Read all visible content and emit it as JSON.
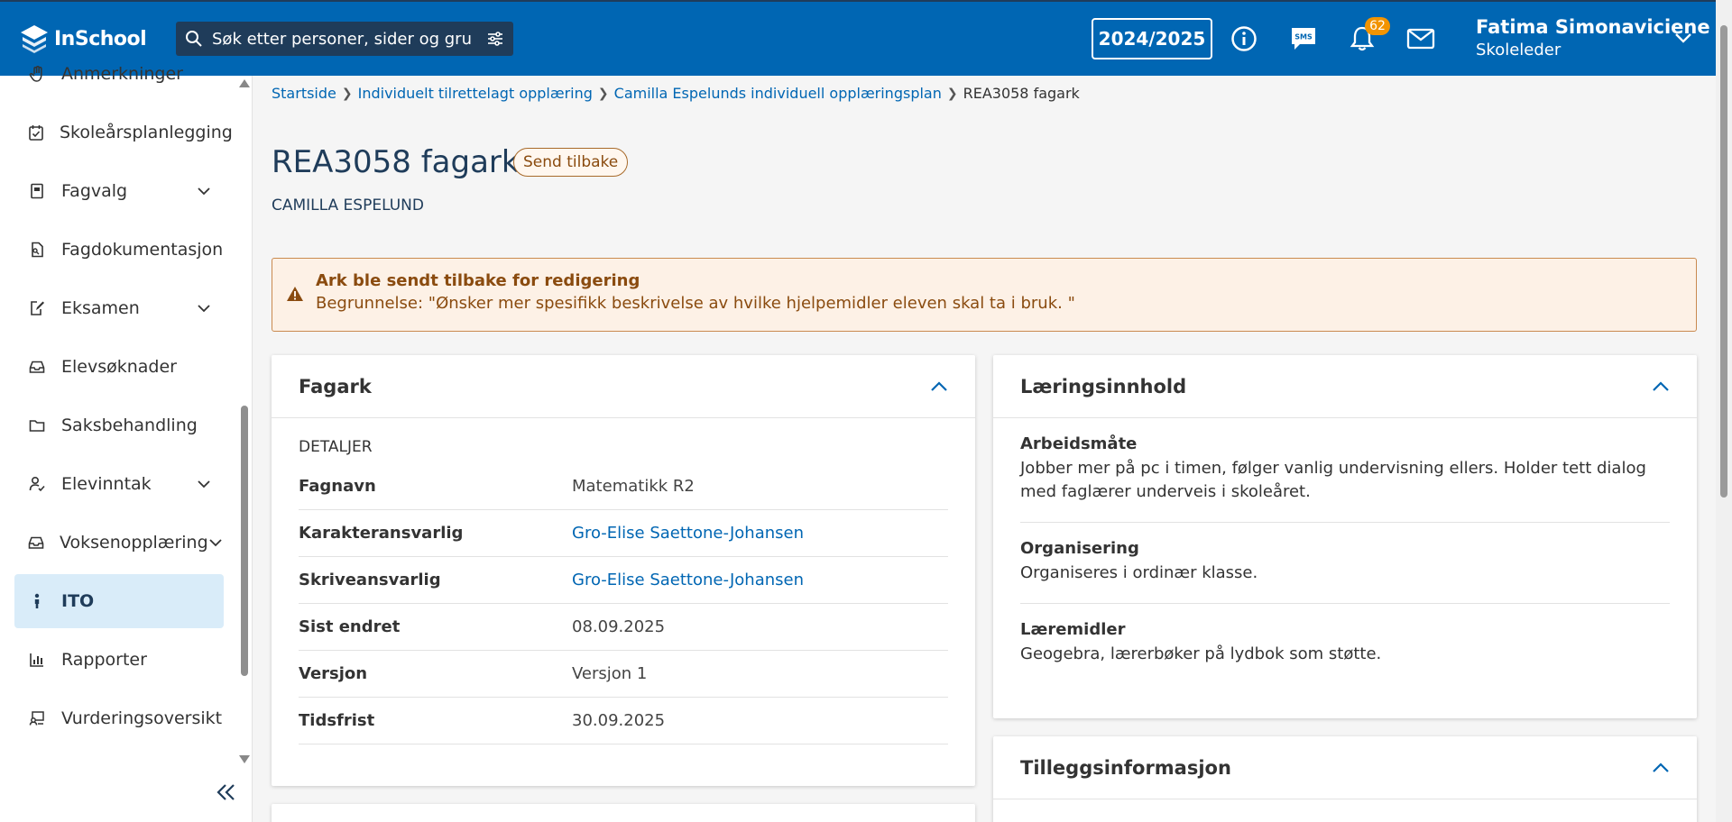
{
  "header": {
    "logo_text": "InSchool",
    "search_placeholder": "Søk etter personer, sider og gru",
    "year": "2024/2025",
    "notifications_count": "62",
    "user_name": "Fatima Simonaviciene",
    "user_role": "Skoleleder"
  },
  "sidebar": {
    "items": [
      {
        "label": "Anmerkninger",
        "icon": "hand-icon",
        "has_chevron": false
      },
      {
        "label": "Skoleårsplanlegging",
        "icon": "calendar-check-icon",
        "has_chevron": false
      },
      {
        "label": "Fagvalg",
        "icon": "book-icon",
        "has_chevron": true
      },
      {
        "label": "Fagdokumentasjon",
        "icon": "document-icon",
        "has_chevron": false
      },
      {
        "label": "Eksamen",
        "icon": "edit-icon",
        "has_chevron": true
      },
      {
        "label": "Elevsøknader",
        "icon": "inbox-icon",
        "has_chevron": false
      },
      {
        "label": "Saksbehandling",
        "icon": "folder-icon",
        "has_chevron": false
      },
      {
        "label": "Elevinntak",
        "icon": "user-check-icon",
        "has_chevron": true
      },
      {
        "label": "Voksenopplæring",
        "icon": "inbox-icon",
        "has_chevron": true
      },
      {
        "label": "ITO",
        "icon": "person-icon",
        "has_chevron": false,
        "active": true
      },
      {
        "label": "Rapporter",
        "icon": "bar-chart-icon",
        "has_chevron": false
      },
      {
        "label": "Vurderingsoversikt",
        "icon": "monitor-icon",
        "has_chevron": false
      }
    ]
  },
  "breadcrumb": {
    "items": [
      "Startside",
      "Individuelt tilrettelagt opplæring",
      "Camilla Espelunds individuell opplæringsplan"
    ],
    "current": "REA3058 fagark"
  },
  "page": {
    "title": "REA3058 fagark",
    "status_tag": "Send tilbake",
    "student": "CAMILLA ESPELUND"
  },
  "alert": {
    "heading": "Ark ble sendt tilbake for redigering",
    "body": "Begrunnelse: \"Ønsker mer spesifikk beskrivelse av hvilke hjelpemidler eleven skal ta i bruk. \""
  },
  "fagark": {
    "title": "Fagark",
    "section": "DETALJER",
    "rows": [
      {
        "key": "Fagnavn",
        "value": "Matematikk R2",
        "link": false
      },
      {
        "key": "Karakteransvarlig",
        "value": "Gro-Elise Saettone-Johansen",
        "link": true
      },
      {
        "key": "Skriveansvarlig",
        "value": "Gro-Elise Saettone-Johansen",
        "link": true
      },
      {
        "key": "Sist endret",
        "value": "08.09.2025",
        "link": false
      },
      {
        "key": "Versjon",
        "value": "Versjon 1",
        "link": false
      },
      {
        "key": "Tidsfrist",
        "value": "30.09.2025",
        "link": false
      }
    ]
  },
  "laeringsinnhold": {
    "title": "Læringsinnhold",
    "sections": [
      {
        "key": "Arbeidsmåte",
        "value": "Jobber mer på pc i timen, følger vanlig undervisning ellers. Holder tett dialog med faglærer underveis i skoleåret."
      },
      {
        "key": "Organisering",
        "value": "Organiseres i ordinær klasse."
      },
      {
        "key": "Læremidler",
        "value": "Geogebra, lærerbøker på lydbok som støtte."
      }
    ]
  },
  "tilleggsinformasjon": {
    "title": "Tilleggsinformasjon"
  },
  "colors": {
    "header": "#0066b3",
    "search_bg": "#1f3c5a",
    "link": "#0066b3",
    "alert_bg": "#fdf1e6",
    "alert_text": "#8a4b0f",
    "badge": "#f29400",
    "active_nav": "#d9ecf9"
  }
}
